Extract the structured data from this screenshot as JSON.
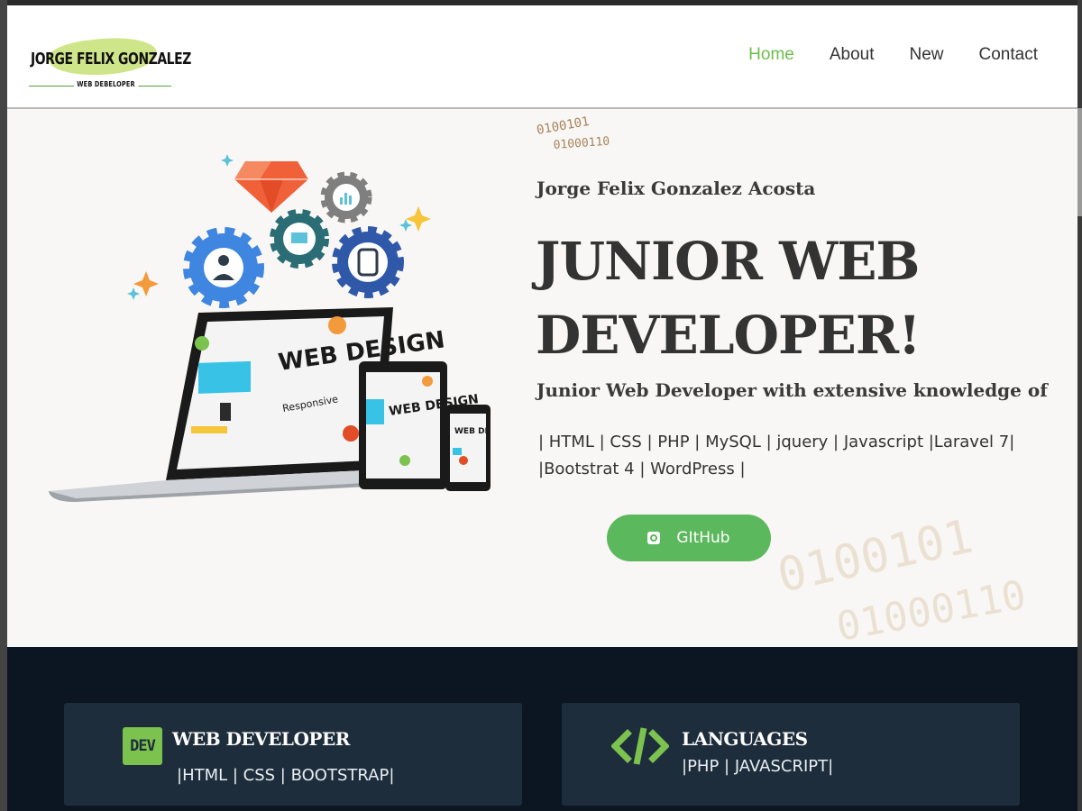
{
  "header": {
    "logo_name": "JORGE FELIX GONZALEZ",
    "logo_tagline": "WEB DEBELOPER",
    "nav": [
      {
        "label": "Home",
        "active": true
      },
      {
        "label": "About",
        "active": false
      },
      {
        "label": "New",
        "active": false
      },
      {
        "label": "Contact",
        "active": false
      }
    ]
  },
  "hero": {
    "binary_small_line1": "0100101",
    "binary_small_line2": "01000110",
    "binary_big_line1": "0100101",
    "binary_big_line2": "01000110",
    "name": "Jorge Felix Gonzalez Acosta",
    "title": "JUNIOR WEB DEVELOPER!",
    "description": "Junior Web Developer with extensive knowledge of",
    "skills": "| HTML | CSS | PHP | MySQL | jquery | Javascript |Laravel 7| |Bootstrat 4 | WordPress |",
    "github_label": "GItHub",
    "illustration_text": "WEB DESIGN",
    "illustration_subtext": "Responsive"
  },
  "cards": [
    {
      "badge": "DEV",
      "title": "WEB DEVELOPER",
      "text": "|HTML | CSS | BOOTSTRAP|"
    },
    {
      "icon": "code-icon",
      "title": "LANGUAGES",
      "text": "|PHP | JAVASCRIPT|"
    }
  ],
  "colors": {
    "accent_green": "#6cbf4c",
    "button_green": "#5cb85c",
    "dark_bg": "#0b1622",
    "card_bg": "#1e2d3b"
  }
}
